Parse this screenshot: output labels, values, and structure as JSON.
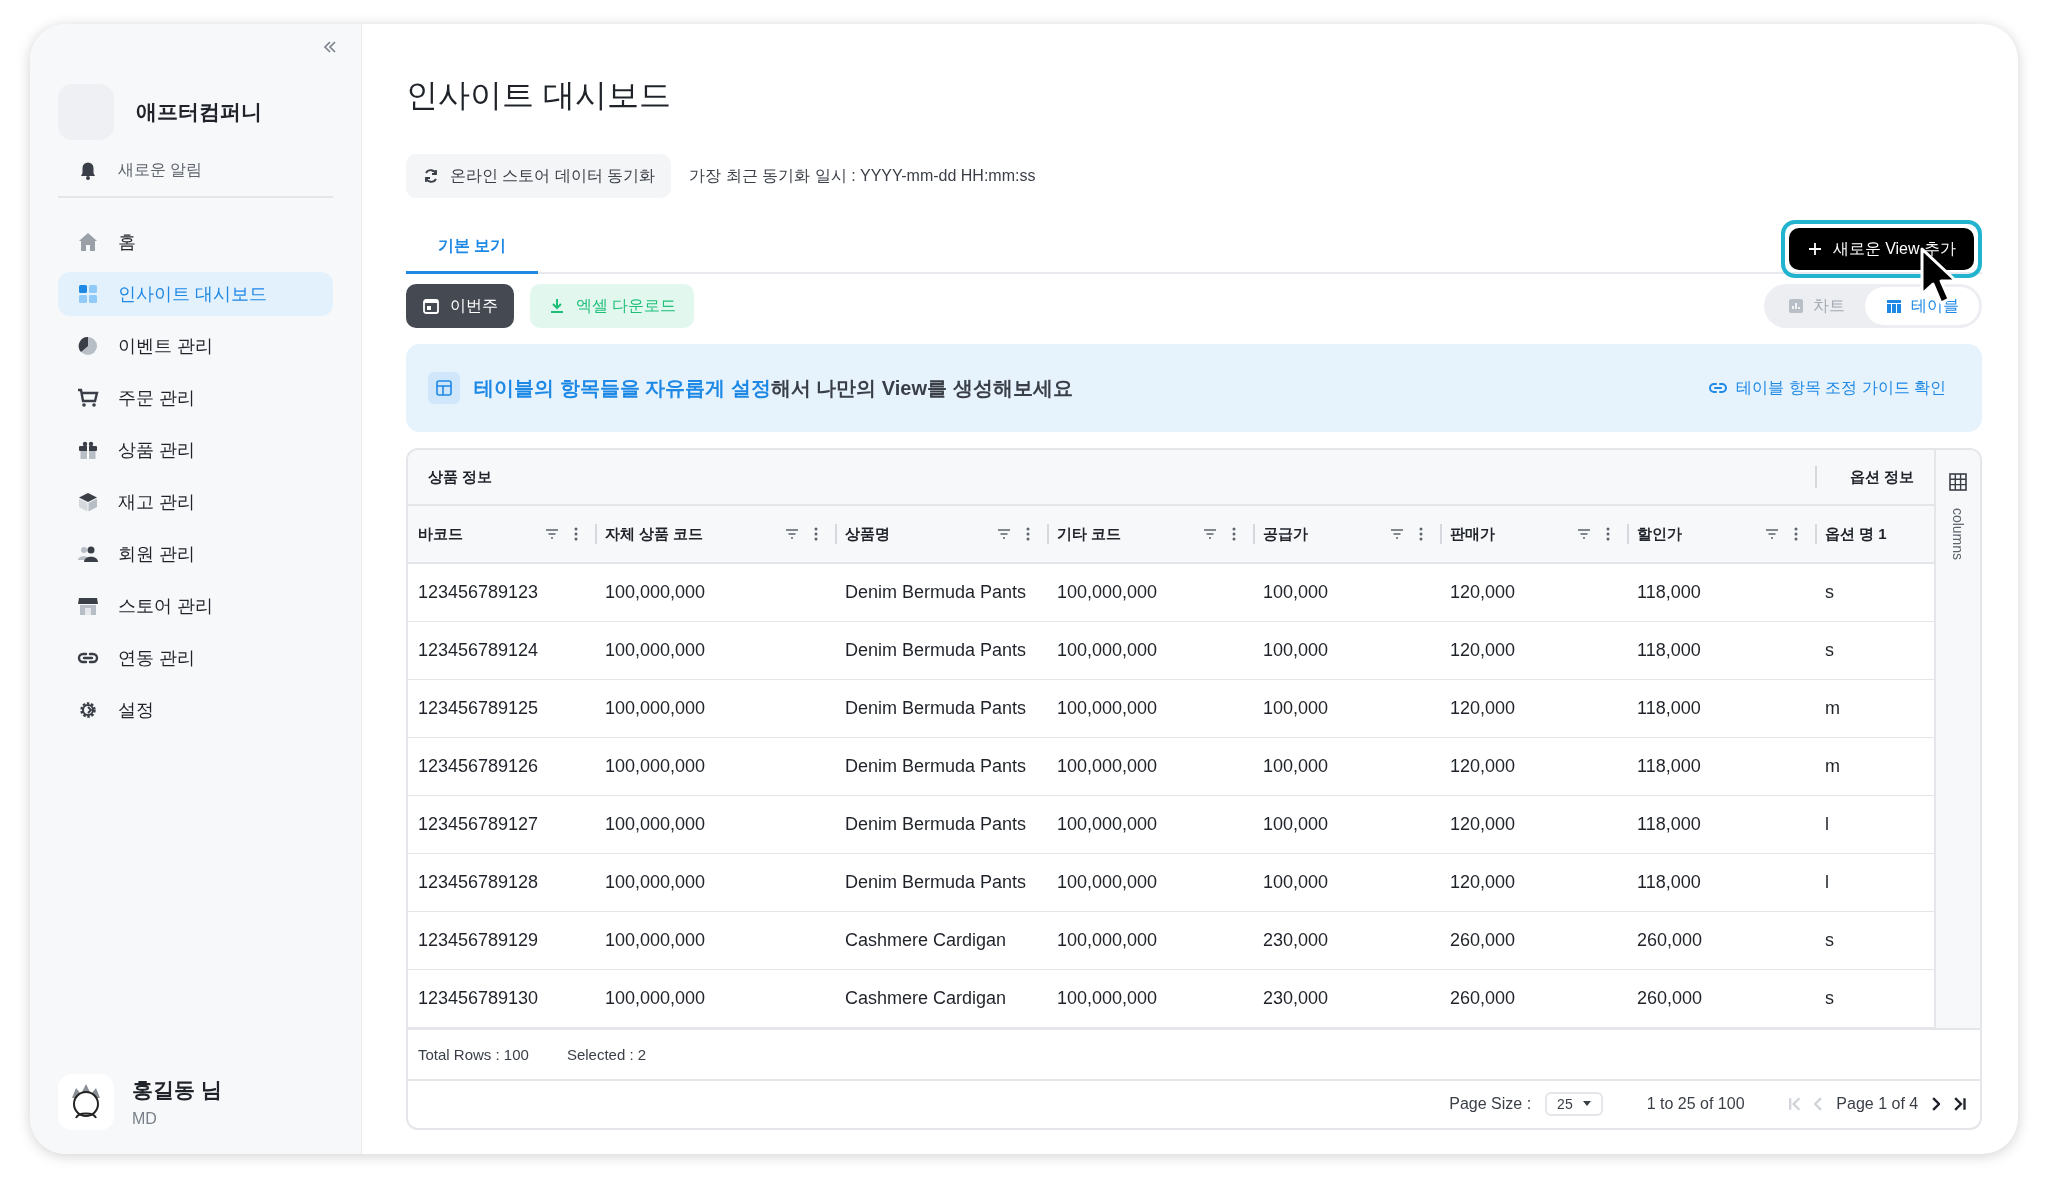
{
  "sidebar": {
    "company": "애프터컴퍼니",
    "notification": "새로운 알림",
    "items": [
      {
        "label": "홈",
        "selected": false
      },
      {
        "label": "인사이트 대시보드",
        "selected": true
      },
      {
        "label": "이벤트 관리",
        "selected": false
      },
      {
        "label": "주문 관리",
        "selected": false
      },
      {
        "label": "상품 관리",
        "selected": false
      },
      {
        "label": "재고 관리",
        "selected": false
      },
      {
        "label": "회원 관리",
        "selected": false
      },
      {
        "label": "스토어 관리",
        "selected": false
      },
      {
        "label": "연동 관리",
        "selected": false
      },
      {
        "label": "설정",
        "selected": false
      }
    ],
    "user": {
      "name": "홍길동 님",
      "role": "MD"
    }
  },
  "page_title": "인사이트 대시보드",
  "sync": {
    "button": "온라인 스토어 데이터 동기화",
    "last_sync": "가장 최근 동기화 일시 : YYYY-mm-dd HH:mm:ss"
  },
  "tabs": [
    {
      "label": "기본 보기",
      "selected": true
    }
  ],
  "new_view_button": {
    "label": "새로운 View 추가",
    "focused": true
  },
  "toolbar": {
    "period": "이번주",
    "download": "엑셀 다운로드"
  },
  "view_toggle": [
    {
      "label": "차트",
      "selected": false
    },
    {
      "label": "테이블",
      "selected": true
    }
  ],
  "banner": {
    "text": "**테이블의 항목들을 자유롭게 설정**해서 나만의 View를 생성해보세요",
    "link": "테이블 항목 조정 가이드 확인"
  },
  "table": {
    "groups": [
      {
        "label": "상품 정보"
      },
      {
        "label": "옵션 정보"
      }
    ],
    "columns": [
      "바코드",
      "자체 상품 코드",
      "상품명",
      "기타 코드",
      "공급가",
      "판매가",
      "할인가",
      "옵션 명 1"
    ],
    "rows": [
      [
        "123456789123",
        "100,000,000",
        "Denim Bermuda Pants",
        "100,000,000",
        "100,000",
        "120,000",
        "118,000",
        "s"
      ],
      [
        "123456789124",
        "100,000,000",
        "Denim Bermuda Pants",
        "100,000,000",
        "100,000",
        "120,000",
        "118,000",
        "s"
      ],
      [
        "123456789125",
        "100,000,000",
        "Denim Bermuda Pants",
        "100,000,000",
        "100,000",
        "120,000",
        "118,000",
        "m"
      ],
      [
        "123456789126",
        "100,000,000",
        "Denim Bermuda Pants",
        "100,000,000",
        "100,000",
        "120,000",
        "118,000",
        "m"
      ],
      [
        "123456789127",
        "100,000,000",
        "Denim Bermuda Pants",
        "100,000,000",
        "100,000",
        "120,000",
        "118,000",
        "l"
      ],
      [
        "123456789128",
        "100,000,000",
        "Denim Bermuda Pants",
        "100,000,000",
        "100,000",
        "120,000",
        "118,000",
        "l"
      ],
      [
        "123456789129",
        "100,000,000",
        "Cashmere Cardigan",
        "100,000,000",
        "230,000",
        "260,000",
        "260,000",
        "s"
      ],
      [
        "123456789130",
        "100,000,000",
        "Cashmere Cardigan",
        "100,000,000",
        "230,000",
        "260,000",
        "260,000",
        "s"
      ]
    ],
    "side_panel": "columns",
    "total_rows": "Total Rows : 100",
    "selected_count": "Selected : 2"
  },
  "pagination": {
    "page_size_label": "Page Size :",
    "page_size": "25",
    "range": "1 to 25 of 100",
    "page": "Page 1 of 4",
    "first_disabled": true,
    "prev_disabled": true,
    "next_disabled": false,
    "last_disabled": false
  }
}
